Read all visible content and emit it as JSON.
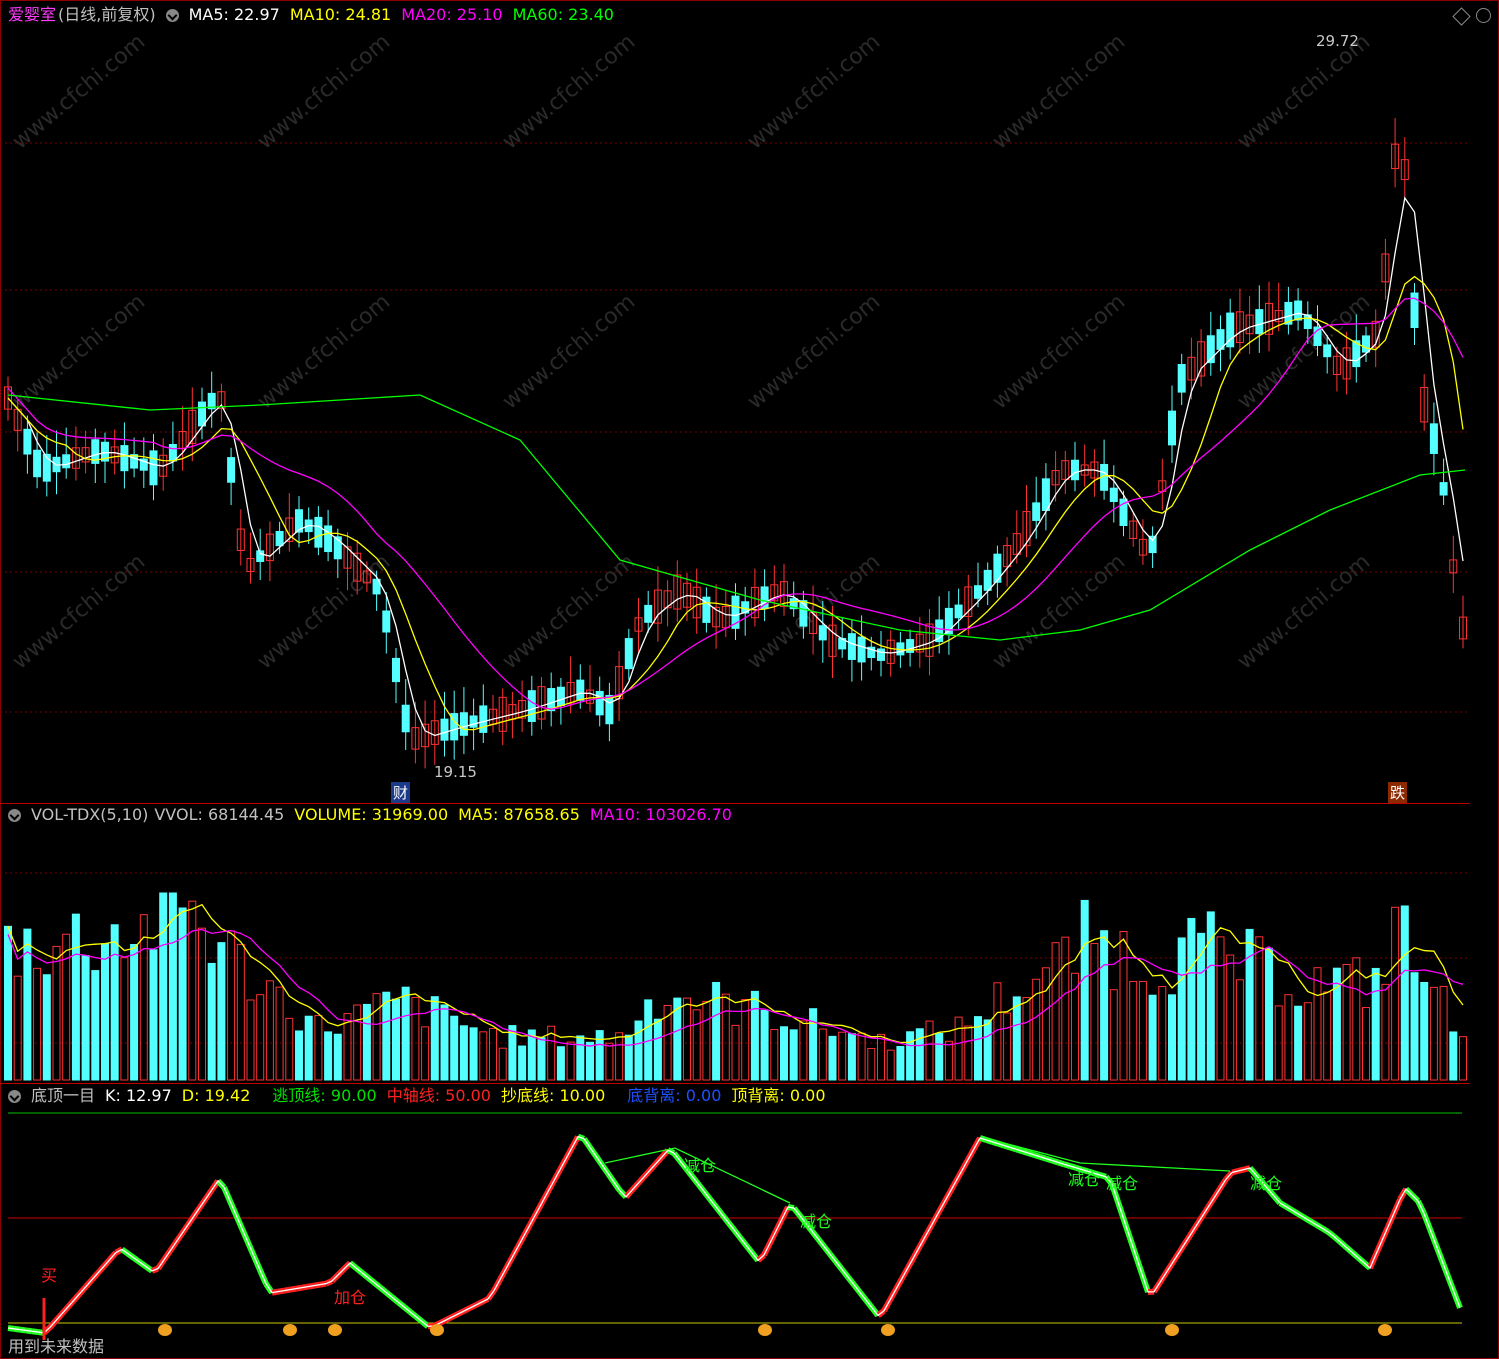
{
  "main": {
    "stock_name": "爱婴室",
    "period": "(日线,前复权)",
    "ma5_label": "MA5: 22.97",
    "ma10_label": "MA10: 24.81",
    "ma20_label": "MA20: 25.10",
    "ma60_label": "MA60: 23.40",
    "high_label": "29.72",
    "low_label": "19.15",
    "tag_fin": "财",
    "tag_limit": "跌",
    "colors": {
      "ma5": "#ffffff",
      "ma10": "#ffff00",
      "ma20": "#ff00ff",
      "ma60": "#00ff00",
      "up": "#ff3232",
      "down": "#54ffff"
    }
  },
  "volume": {
    "name": "VOL-TDX(5,10)",
    "vvol": "VVOL: 68144.45",
    "volume": "VOLUME: 31969.00",
    "ma5": "MA5: 87658.65",
    "ma10": "MA10: 103026.70"
  },
  "indicator": {
    "name": "底顶一目",
    "k": "K: 12.97",
    "d": "D: 19.42",
    "top_line": "逃顶线: 90.00",
    "mid_line": "中轴线: 50.00",
    "bottom_line": "抄底线: 10.00",
    "bottom_div": "底背离: 0.00",
    "top_div": "顶背离: 0.00",
    "buy_label": "买",
    "add_label": "加仓",
    "reduce_labels": [
      "减仓",
      "减仓",
      "减仓",
      "减仓",
      "减仓"
    ],
    "future_data": "用到未来数据"
  },
  "watermark": "www.cfchi.com"
}
